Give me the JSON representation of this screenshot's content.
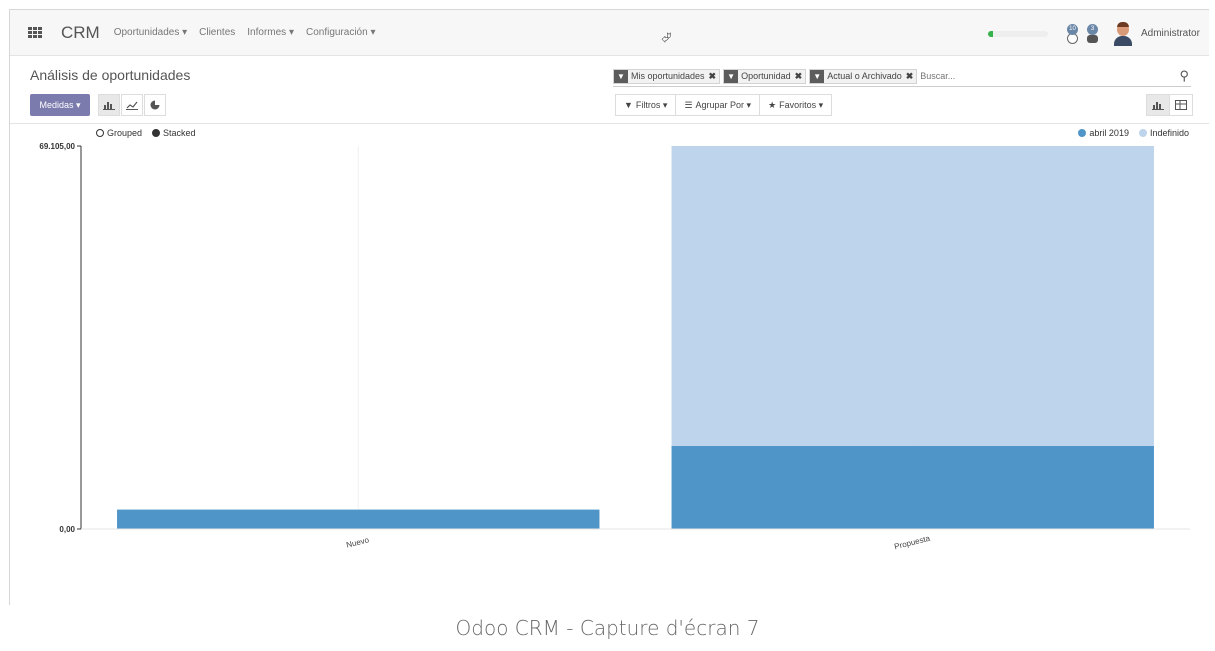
{
  "navbar": {
    "brand": "CRM",
    "menu": [
      {
        "label": "Oportunidades ▾"
      },
      {
        "label": "Clientes"
      },
      {
        "label": "Informes ▾"
      },
      {
        "label": "Configuración ▾"
      }
    ],
    "progress_fraction": 0.08,
    "activity_badge": "10",
    "chat_badge": "3",
    "user_name": "Administrator",
    "accent_color": "#36b24d"
  },
  "control_panel": {
    "title": "Análisis de oportunidades",
    "measures_label": "Medidas ▾",
    "facets": [
      {
        "label": "Mis oportunidades"
      },
      {
        "label": "Oportunidad"
      },
      {
        "label": "Actual o Archivado"
      }
    ],
    "search_placeholder": "Buscar...",
    "filters_label": "Filtros ▾",
    "groupby_label": "Agrupar Por ▾",
    "favorites_label": "Favoritos ▾",
    "primary_color": "#7c7bad"
  },
  "chart_data": {
    "type": "bar",
    "mode": "stacked",
    "options": [
      {
        "label": "Grouped",
        "selected": false
      },
      {
        "label": "Stacked",
        "selected": true
      }
    ],
    "categories": [
      "Nuevo",
      "Propuesta"
    ],
    "series": [
      {
        "name": "abril 2019",
        "color": "#4f95c8",
        "values": [
          3500,
          15000
        ]
      },
      {
        "name": "Indefinido",
        "color": "#bdd4ec",
        "values": [
          0,
          54105
        ]
      }
    ],
    "y_tick_labels": [
      "69.105,00",
      "0,00"
    ],
    "ylim": [
      0,
      69105
    ],
    "legend_position": "top-right"
  },
  "caption": "Odoo CRM - Capture d'écran 7"
}
